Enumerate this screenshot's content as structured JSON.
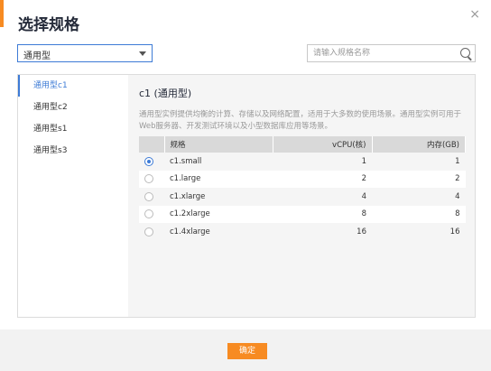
{
  "dialog": {
    "title": "选择规格",
    "close_label": "×"
  },
  "filter": {
    "selected": "通用型"
  },
  "search": {
    "placeholder": "请输入规格名称"
  },
  "sidebar": {
    "items": [
      {
        "label": "通用型c1",
        "active": true
      },
      {
        "label": "通用型c2",
        "active": false
      },
      {
        "label": "通用型s1",
        "active": false
      },
      {
        "label": "通用型s3",
        "active": false
      }
    ]
  },
  "content": {
    "title": "c1 (通用型)",
    "description": "通用型实例提供均衡的计算、存储以及网络配置，适用于大多数的使用场景。通用型实例可用于Web服务器、开发测试环境以及小型数据库应用等场景。"
  },
  "table": {
    "headers": {
      "spec": "规格",
      "vcpu": "vCPU(核)",
      "memory": "内存(GB)"
    },
    "rows": [
      {
        "spec": "c1.small",
        "vcpu": "1",
        "memory": "1",
        "selected": true
      },
      {
        "spec": "c1.large",
        "vcpu": "2",
        "memory": "2",
        "selected": false
      },
      {
        "spec": "c1.xlarge",
        "vcpu": "4",
        "memory": "4",
        "selected": false
      },
      {
        "spec": "c1.2xlarge",
        "vcpu": "8",
        "memory": "8",
        "selected": false
      },
      {
        "spec": "c1.4xlarge",
        "vcpu": "16",
        "memory": "16",
        "selected": false
      }
    ]
  },
  "footer": {
    "confirm_label": "确定"
  },
  "colors": {
    "accent": "#f78b22",
    "primary": "#3d7bd6"
  }
}
